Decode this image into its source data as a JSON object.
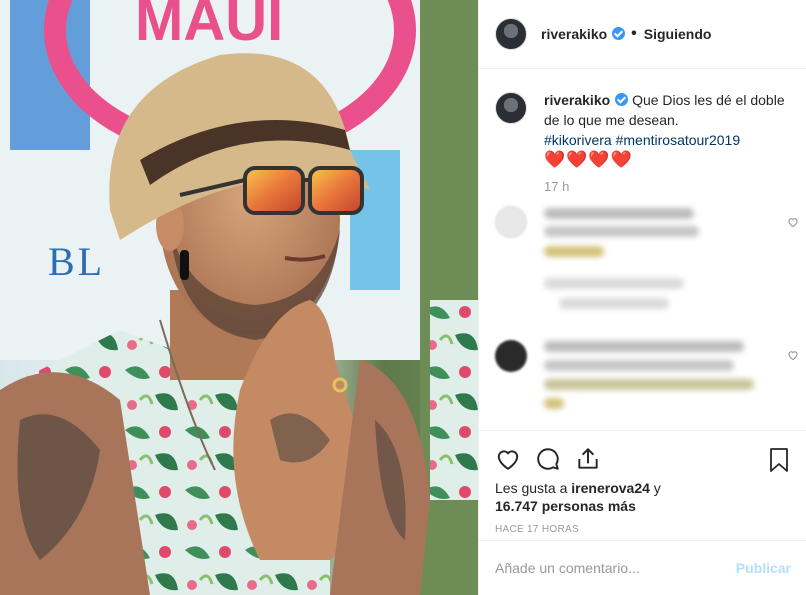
{
  "header": {
    "username": "riverakiko",
    "separator": "•",
    "follow_status": "Siguiendo"
  },
  "caption": {
    "username": "riverakiko",
    "text": "Que Dios les dé el doble de lo que me desean.",
    "hashtags": [
      "#kikorivera",
      "#mentirosatour2019"
    ],
    "emoji": "❤️❤️❤️❤️",
    "time": "17 h"
  },
  "post_image": {
    "banner_text": "MAUI",
    "sign_text": "BL"
  },
  "icons": {
    "verified": "verified-badge-icon",
    "like": "heart-outline-icon",
    "comment": "speech-bubble-icon",
    "share": "share-icon",
    "save": "bookmark-icon"
  },
  "likes": {
    "prefix": "Les gusta a ",
    "user": "irenerova24",
    "suffix": " y",
    "count": "16.747 personas más"
  },
  "posted_ago": "HACE 17 HORAS",
  "add_comment": {
    "placeholder": "Añade un comentario...",
    "publish_label": "Publicar"
  },
  "colors": {
    "verified_blue": "#3897f0",
    "hashtag": "#003569",
    "publish_disabled": "#b2dffc",
    "muted": "#999999"
  }
}
